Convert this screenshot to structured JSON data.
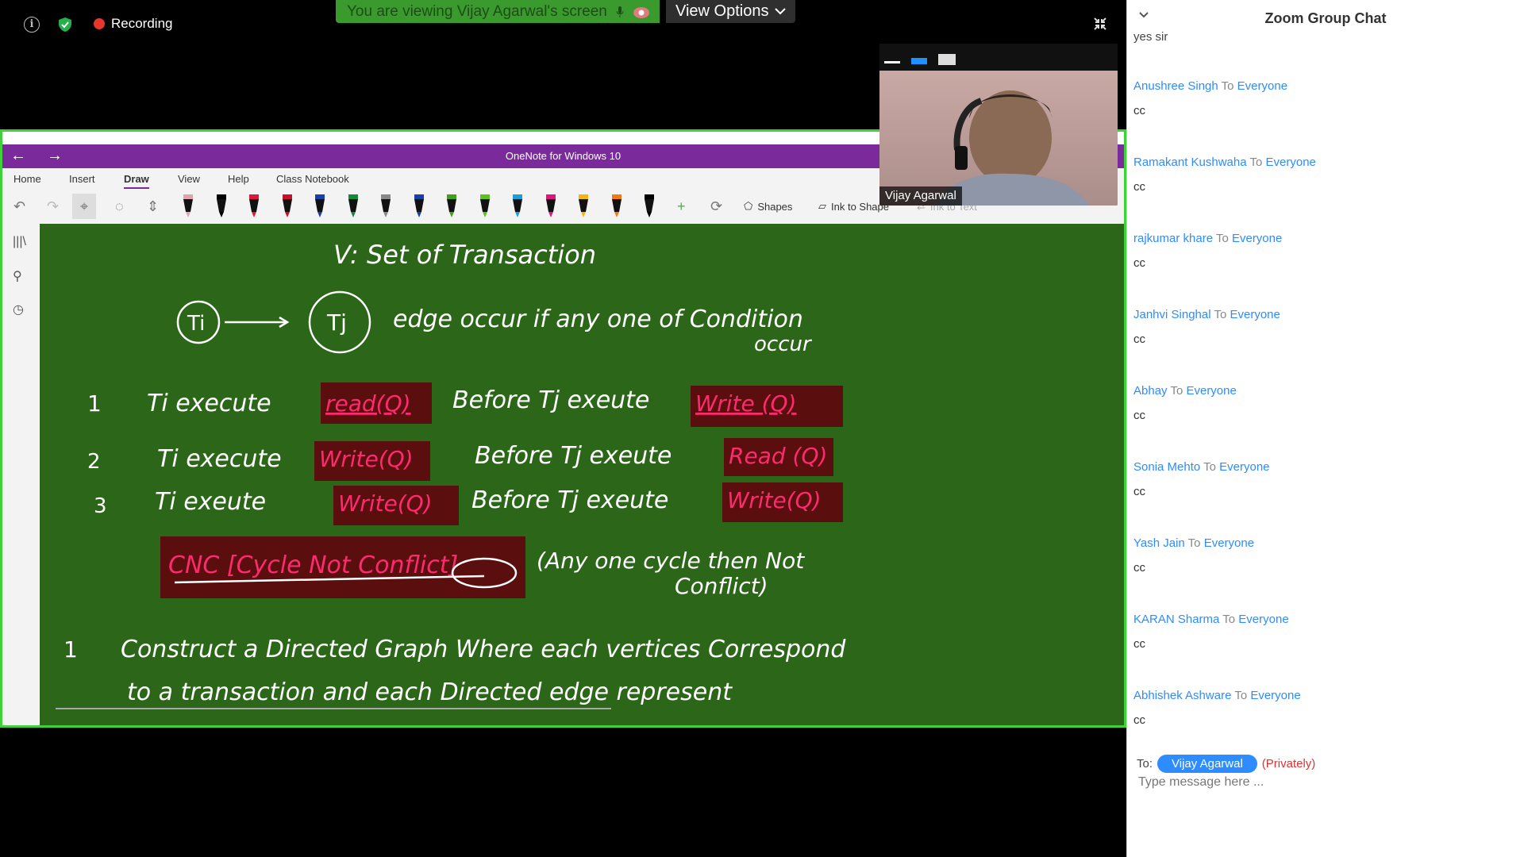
{
  "zoom": {
    "recording_label": "Recording",
    "viewing_text": "You are viewing Vijay Agarwal's screen",
    "view_options_label": "View Options"
  },
  "onenote": {
    "window_title": "OneNote for Windows 10",
    "menu": [
      "Home",
      "Insert",
      "Draw",
      "View",
      "Help",
      "Class Notebook"
    ],
    "active_menu": "Draw",
    "tools": {
      "shapes": "Shapes",
      "ink_to_shape": "Ink to Shape",
      "ink_to_text": "Ink to Text"
    },
    "pen_colors": [
      "#e3a1b0",
      "#000000",
      "#d81b3a",
      "#c8102e",
      "#1a3fa8",
      "#128a3a",
      "#888888",
      "#1a3fa8",
      "#3fa11b",
      "#5ec21b",
      "#1aa0d8",
      "#d81b7a",
      "#f2b70f",
      "#f27b0f",
      "#000000"
    ]
  },
  "notes": {
    "title": "V: Set of Transaction",
    "edge_node_a": "Ti",
    "edge_node_b": "Tj",
    "edge_text_1": "edge occur if any one of Condition",
    "edge_text_2": "occur",
    "rules": [
      {
        "num": "1",
        "prefix": "Ti execute",
        "op1": "read(Q)",
        "mid": "Before Tj exeute",
        "op2": "Write (Q)"
      },
      {
        "num": "2",
        "prefix": "Ti execute",
        "op1": "Write(Q)",
        "mid": "Before Tj exeute",
        "op2": "Read (Q)"
      },
      {
        "num": "3",
        "prefix": "Ti exeute",
        "op1": "Write(Q)",
        "mid": "Before Tj exeute",
        "op2": "Write(Q)"
      }
    ],
    "cnc": "CNC [Cycle Not Conflict]",
    "any_cycle_1": "(Any one cycle then Not",
    "any_cycle_2": "Conflict)",
    "step_num": "1",
    "step_line_1": "Construct a Directed Graph Where each vertices Correspond",
    "step_line_2": "to a transaction and each Directed edge represent"
  },
  "video": {
    "name": "Vijay Agarwal"
  },
  "chat": {
    "title": "Zoom Group Chat",
    "first_partial": "yes sir",
    "to_word": "To",
    "everyone": "Everyone",
    "messages": [
      {
        "sender": "Anushree Singh",
        "text": "cc"
      },
      {
        "sender": "Ramakant Kushwaha",
        "text": "cc"
      },
      {
        "sender": "rajkumar khare",
        "text": "cc"
      },
      {
        "sender": "Janhvi Singhal",
        "text": "cc"
      },
      {
        "sender": "Abhay",
        "text": "cc"
      },
      {
        "sender": "Sonia Mehto",
        "text": "cc"
      },
      {
        "sender": "Yash Jain",
        "text": "cc"
      },
      {
        "sender": "KARAN Sharma",
        "text": "cc"
      },
      {
        "sender": "Abhishek Ashware",
        "text": "cc"
      }
    ],
    "to_label": "To:",
    "recipient": "Vijay Agarwal",
    "privately": "(Privately)",
    "input_placeholder": "Type message here ..."
  }
}
